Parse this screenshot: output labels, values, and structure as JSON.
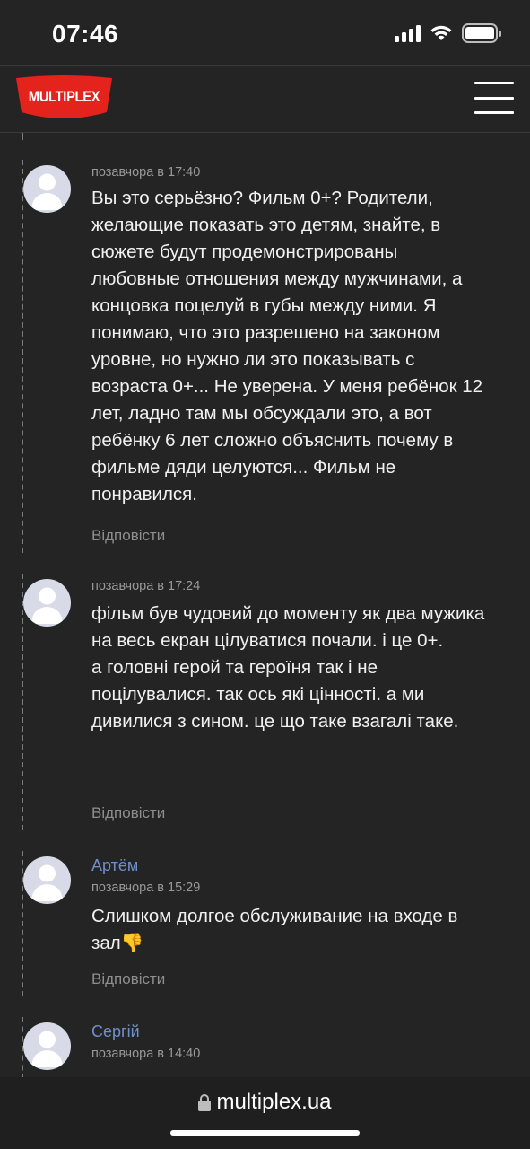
{
  "status": {
    "time": "07:46"
  },
  "header": {
    "logo_text": "MULTIPLEX",
    "brand_color": "#e4231c",
    "menu_icon": "hamburger-icon"
  },
  "comments": [
    {
      "author": "",
      "time": "позавчора в 17:40",
      "text": "Вы это серьёзно? Фильм 0+? Родители, желающие показать это детям, знайте, в сюжете будут продемонстрированы любовные отношения между мужчинами, а концовка поцелуй в губы между ними. Я понимаю, что это разрешено на законом уровне, но нужно ли это показывать с возраста 0+... Не уверена. У меня ребёнок 12 лет, ладно там мы обсуждали это, а вот ребёнку 6 лет сложно объяснить почему в фильме дяди целуются... Фильм не понравился.",
      "reply": "Відповісти"
    },
    {
      "author": "",
      "time": "позавчора в 17:24",
      "text_lines": [
        "фільм був чудовий до моменту як два мужика на весь екран цілуватися почали. і це 0+.",
        "а головні герой та героїня так і не поцілувалися. так ось які цінності. а ми дивилися з сином. це що таке взагалі таке."
      ],
      "reply": "Відповісти"
    },
    {
      "author": "Артём",
      "time": "позавчора в 15:29",
      "text": "Слишком долгое обслуживание на входе в зал👎",
      "reply": "Відповісти"
    },
    {
      "author": "Сергій",
      "time": "позавчора в 14:40",
      "text": "",
      "reply": ""
    }
  ],
  "address_bar": {
    "url": "multiplex.ua",
    "lock_icon": "lock-icon"
  }
}
